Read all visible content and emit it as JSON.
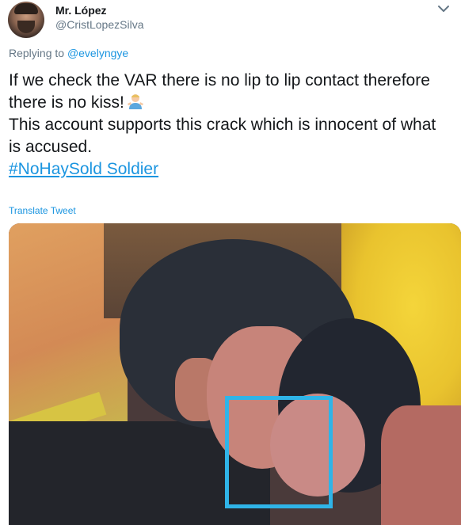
{
  "tweet": {
    "display_name": "Mr. López",
    "handle": "@CristLopezSilva",
    "reply_prefix": "Replying to",
    "reply_to": "@evelyngye",
    "body_line1": "If we check the VAR there is no lip to lip contact therefore there is no kiss!",
    "body_line2": "This account supports this crack which is innocent of what is accused.",
    "hashtag": "#NoHaySold Soldier",
    "translate_label": "Translate Tweet"
  },
  "icons": {
    "avatar": "user-avatar",
    "menu": "chevron-down-icon",
    "emoji": "man-shrugging-emoji"
  },
  "colors": {
    "link": "#1b95e0",
    "muted": "#657786",
    "text": "#14171a",
    "highlight_box": "#2fb4e8"
  }
}
